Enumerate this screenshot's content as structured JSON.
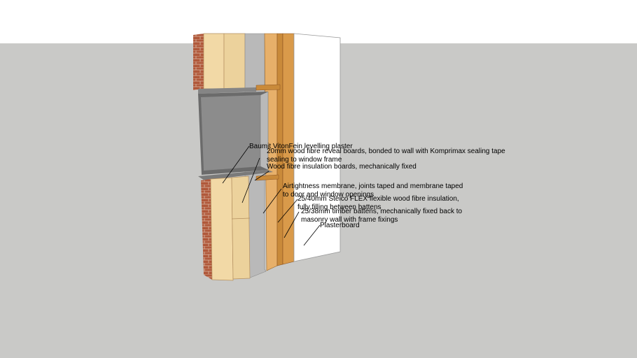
{
  "colors": {
    "sky": "#ffffff",
    "ground": "#c9c9c7",
    "brick": "#b0583a",
    "brick_mortar": "#d9b9a4",
    "woodfibre": "#f2d9a6",
    "woodfibre_dark": "#dcbf86",
    "reveal_grey": "#858585",
    "membrane": "#b9b9b9",
    "batten": "#c98a3a",
    "batten_dark": "#8a5220",
    "insulation": "#e7b06a",
    "plasterboard": "#ffffff",
    "window_frame": "#6b6b6b",
    "glass": "#8c8c8c"
  },
  "labels": [
    {
      "id": "render",
      "text": "Baumit VitonFein levelling plaster"
    },
    {
      "id": "reveal",
      "line1": "20mm wood fibre reveal boards, bonded to wall with Komprimax sealing tape",
      "line2": "sealing to window frame"
    },
    {
      "id": "woodfibre",
      "text": "Wood fibre insulation boards, mechanically fixed"
    },
    {
      "id": "airtight",
      "line1": "Airtightness membrane, joints taped and membrane taped",
      "line2": "to door and window openings"
    },
    {
      "id": "steico",
      "line1": "25/40mm Steico FLEX flexible wood fibre insulation,",
      "line2": "fully filling between battens"
    },
    {
      "id": "battens",
      "line1": "25/38mm timber battens, mechanically fixed back to",
      "line2": "masonry wall with frame fixings"
    },
    {
      "id": "plasterboard",
      "text": "Plasterboard"
    }
  ]
}
